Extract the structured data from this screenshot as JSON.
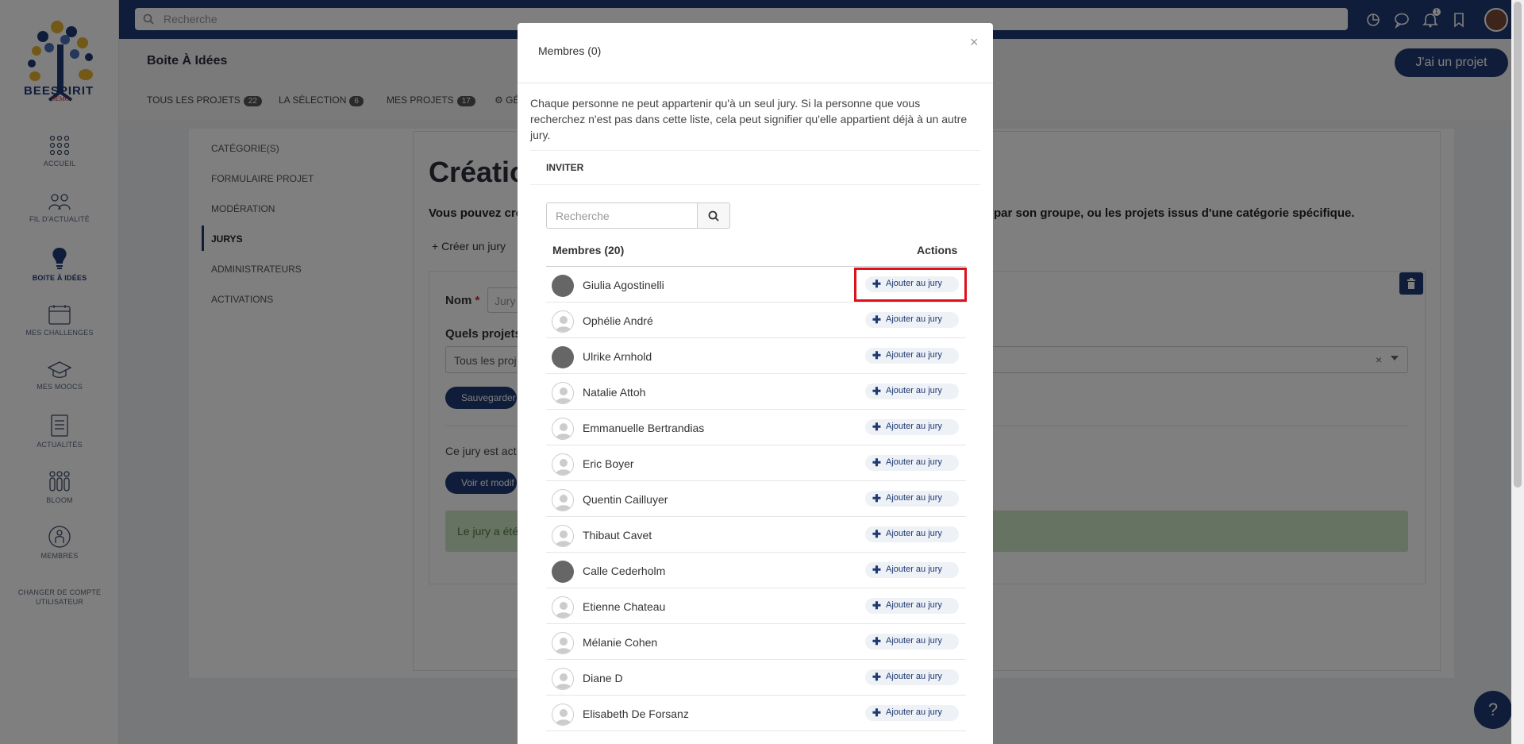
{
  "app": {
    "logo_text": "BEESPIRIT",
    "logo_demo": "DEMO",
    "search_placeholder": "Recherche",
    "notification_count": "1"
  },
  "sidebar": {
    "items": [
      {
        "label": "ACCUEIL",
        "icon": "grid-icon"
      },
      {
        "label": "FIL D'ACTUALITÉ",
        "icon": "people-icon"
      },
      {
        "label": "BOITE À IDÉES",
        "icon": "lightbulb-icon"
      },
      {
        "label": "MES CHALLENGES",
        "icon": "calendar-icon"
      },
      {
        "label": "MES MOOCS",
        "icon": "graduation-cap-icon"
      },
      {
        "label": "ACTUALITÉS",
        "icon": "document-icon"
      },
      {
        "label": "BLOOM",
        "icon": "group-icon"
      },
      {
        "label": "MEMBRES",
        "icon": "member-icon"
      }
    ],
    "switch_account_line1": "CHANGER DE COMPTE",
    "switch_account_line2": "UTILISATEUR"
  },
  "header": {
    "title": "Boite À Idées",
    "cta_label": "J'ai un projet",
    "tabs": [
      {
        "label": "TOUS LES PROJETS",
        "count": "22"
      },
      {
        "label": "LA SÉLECTION",
        "count": "6"
      },
      {
        "label": "MES PROJETS",
        "count": "17"
      },
      {
        "label": "GÉ"
      }
    ]
  },
  "subnav": {
    "items": [
      "CATÉGORIE(S)",
      "FORMULAIRE PROJET",
      "MODÉRATION",
      "JURYS",
      "ADMINISTRATEURS",
      "ACTIVATIONS"
    ]
  },
  "form": {
    "title": "Création",
    "intro_left": "Vous pouvez cre",
    "intro_right": "par son groupe, ou les projets issus d'une catégorie spécifique.",
    "create_link": "Créer un jury",
    "nom_label": "Nom",
    "required_mark": "*",
    "nom_placeholder": "Jury",
    "quels_label": "Quels projets",
    "select_value": "Tous les proj",
    "save_label": "Sauvegarder",
    "active_text": "Ce jury est act",
    "voir_label": "Voir et modif",
    "alert_text": "Le jury a été"
  },
  "modal": {
    "title": "Membres (0)",
    "close": "×",
    "info": "Chaque personne ne peut appartenir qu'à un seul jury. Si la personne que vous recherchez n'est pas dans cette liste, cela peut signifier qu'elle appartient déjà à un autre jury.",
    "invite_label": "INVITER",
    "search_placeholder": "Recherche",
    "col_members": "Membres (20)",
    "col_actions": "Actions",
    "add_label": "Ajouter au jury",
    "members": [
      {
        "name": "Giulia Agostinelli",
        "avatar": "dark"
      },
      {
        "name": "Ophélie André",
        "avatar": "blank"
      },
      {
        "name": "Ulrike Arnhold",
        "avatar": "dark"
      },
      {
        "name": "Natalie Attoh",
        "avatar": "blank"
      },
      {
        "name": "Emmanuelle Bertrandias",
        "avatar": "blank"
      },
      {
        "name": "Eric Boyer",
        "avatar": "blank"
      },
      {
        "name": "Quentin Cailluyer",
        "avatar": "blank"
      },
      {
        "name": "Thibaut Cavet",
        "avatar": "blank"
      },
      {
        "name": "Calle Cederholm",
        "avatar": "dark"
      },
      {
        "name": "Etienne Chateau",
        "avatar": "blank"
      },
      {
        "name": "Mélanie Cohen",
        "avatar": "blank"
      },
      {
        "name": "Diane D",
        "avatar": "blank"
      },
      {
        "name": "Elisabeth De Forsanz",
        "avatar": "blank"
      }
    ]
  },
  "help_label": "?",
  "colors": {
    "brand": "#1e3a74",
    "highlight": "#e0101a"
  }
}
